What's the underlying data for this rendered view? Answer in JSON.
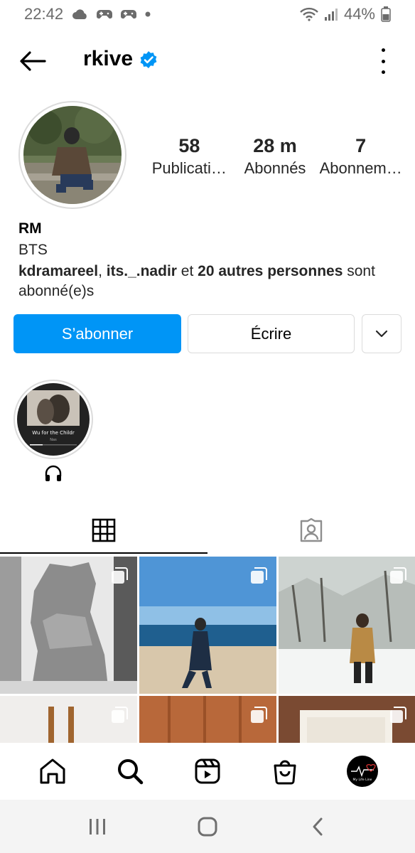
{
  "status_bar": {
    "time": "22:42",
    "battery": "44%",
    "icons": [
      "cloud-icon",
      "game-controller-icon",
      "game-controller-icon",
      "dot-icon",
      "wifi-icon",
      "signal-icon",
      "battery-icon"
    ]
  },
  "header": {
    "username": "rkive",
    "verified": true
  },
  "profile": {
    "stats": [
      {
        "value": "58",
        "label": "Publicati…"
      },
      {
        "value": "28 m",
        "label": "Abonnés"
      },
      {
        "value": "7",
        "label": "Abonnem…"
      }
    ],
    "name": "RM",
    "category": "BTS",
    "followed_by": {
      "user1": "kdramareel",
      "sep": ", ",
      "user2": "its._.nadir",
      "mid": " et ",
      "others": "20 autres personnes",
      "suffix": " sont abonné(e)s"
    }
  },
  "actions": {
    "follow": "S’abonner",
    "message": "Écrire"
  },
  "highlight": {
    "thumb_text": "Wu for the Childr",
    "thumb_subtext": "Nas",
    "label_icon": "headphones-icon"
  },
  "tabs": [
    {
      "name": "grid-icon",
      "active": true
    },
    {
      "name": "tagged-icon",
      "active": false
    }
  ],
  "colors": {
    "accent": "#0095f6",
    "verified": "#0095f6",
    "border": "#dbdbdb",
    "text": "#262626"
  },
  "bottom_nav": [
    "home-icon",
    "search-icon",
    "reels-icon",
    "shop-icon",
    "profile-avatar"
  ],
  "my_avatar_text": "My Life Line",
  "system_nav": [
    "recents-icon",
    "home-circle-icon",
    "back-chevron-icon"
  ]
}
